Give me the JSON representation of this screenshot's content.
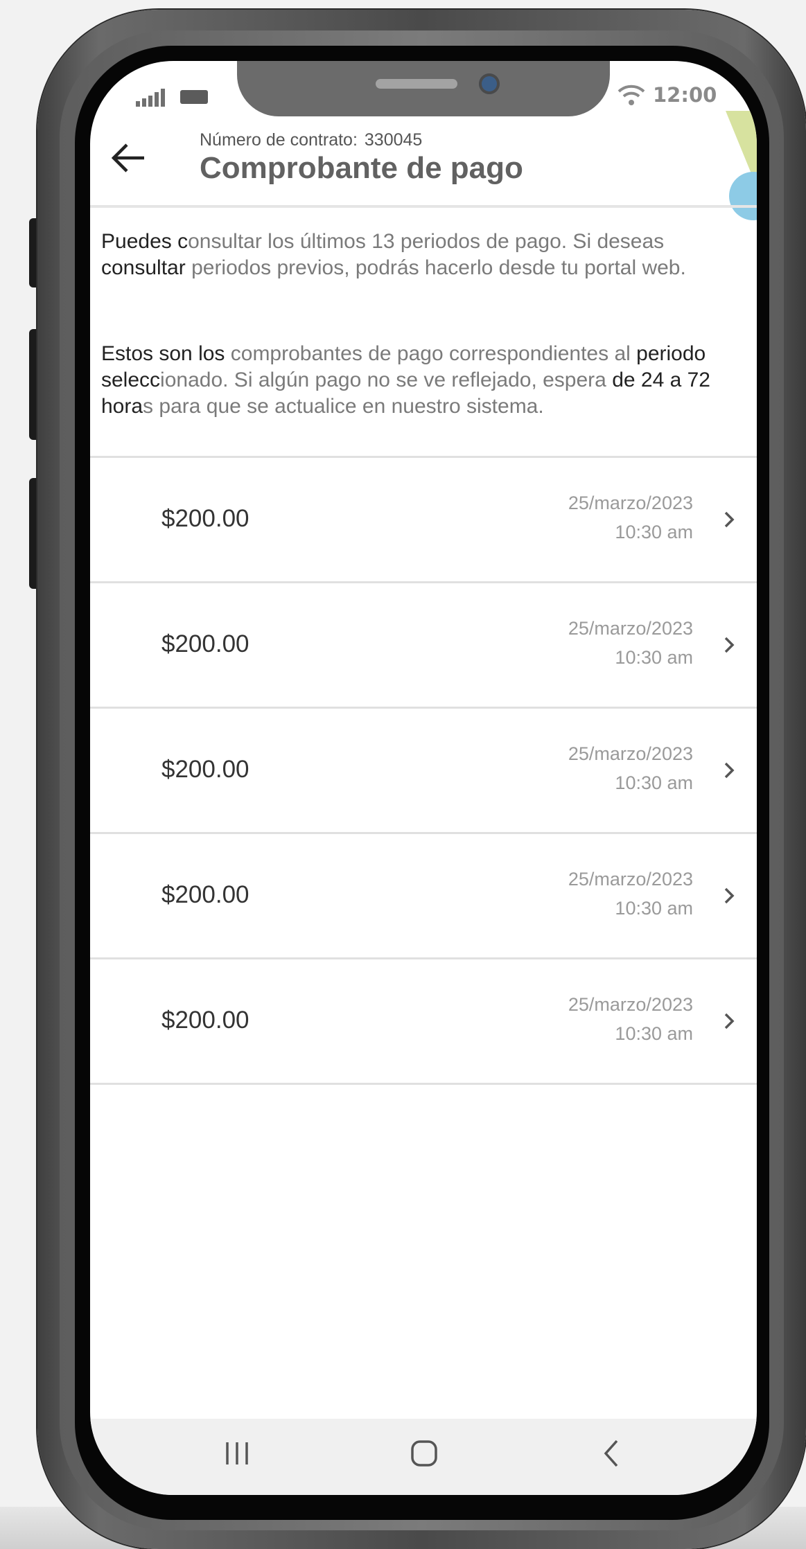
{
  "status_bar": {
    "time": "12:00"
  },
  "header": {
    "contract_label": "Número de contrato:",
    "contract_number": "330045",
    "title": "Comprobante de pago"
  },
  "info": {
    "p1_lead": "Puedes c",
    "p1_rest": "onsultar los últimos 13 periodos de pago. Si deseas ",
    "p1_lead2": "consultar",
    "p1_rest2": " periodos previos, podrás hacerlo desde tu portal web.",
    "p2_lead": "Estos son los",
    "p2_rest": " comprobantes de pago correspondientes al ",
    "p2_lead2": "periodo selecc",
    "p2_rest2": "ionado. Si algún pago no se ve reflejado, espera ",
    "p2_lead3": "de 24 a 72 hora",
    "p2_rest3": "s para que se actualice en nuestro sistema."
  },
  "payments": [
    {
      "amount": "$200.00",
      "date": "25/marzo/2023",
      "time": "10:30 am"
    },
    {
      "amount": "$200.00",
      "date": "25/marzo/2023",
      "time": "10:30 am"
    },
    {
      "amount": "$200.00",
      "date": "25/marzo/2023",
      "time": "10:30 am"
    },
    {
      "amount": "$200.00",
      "date": "25/marzo/2023",
      "time": "10:30 am"
    },
    {
      "amount": "$200.00",
      "date": "25/marzo/2023",
      "time": "10:30 am"
    }
  ],
  "icons": {
    "back": "arrow-left",
    "row": "chevron-right",
    "nav_recent": "recent-apps",
    "nav_home": "home",
    "nav_back": "chevron-left",
    "wifi": "wifi",
    "signal": "signal-bars",
    "battery": "battery"
  },
  "colors": {
    "title": "#616161",
    "lead_text": "#222222",
    "body_text": "#7a7a7a",
    "divider": "#e0e0e0",
    "nav_bg": "#f0f0f0",
    "accent_green": "#d7e29f",
    "accent_blue": "#8dcbe6"
  }
}
